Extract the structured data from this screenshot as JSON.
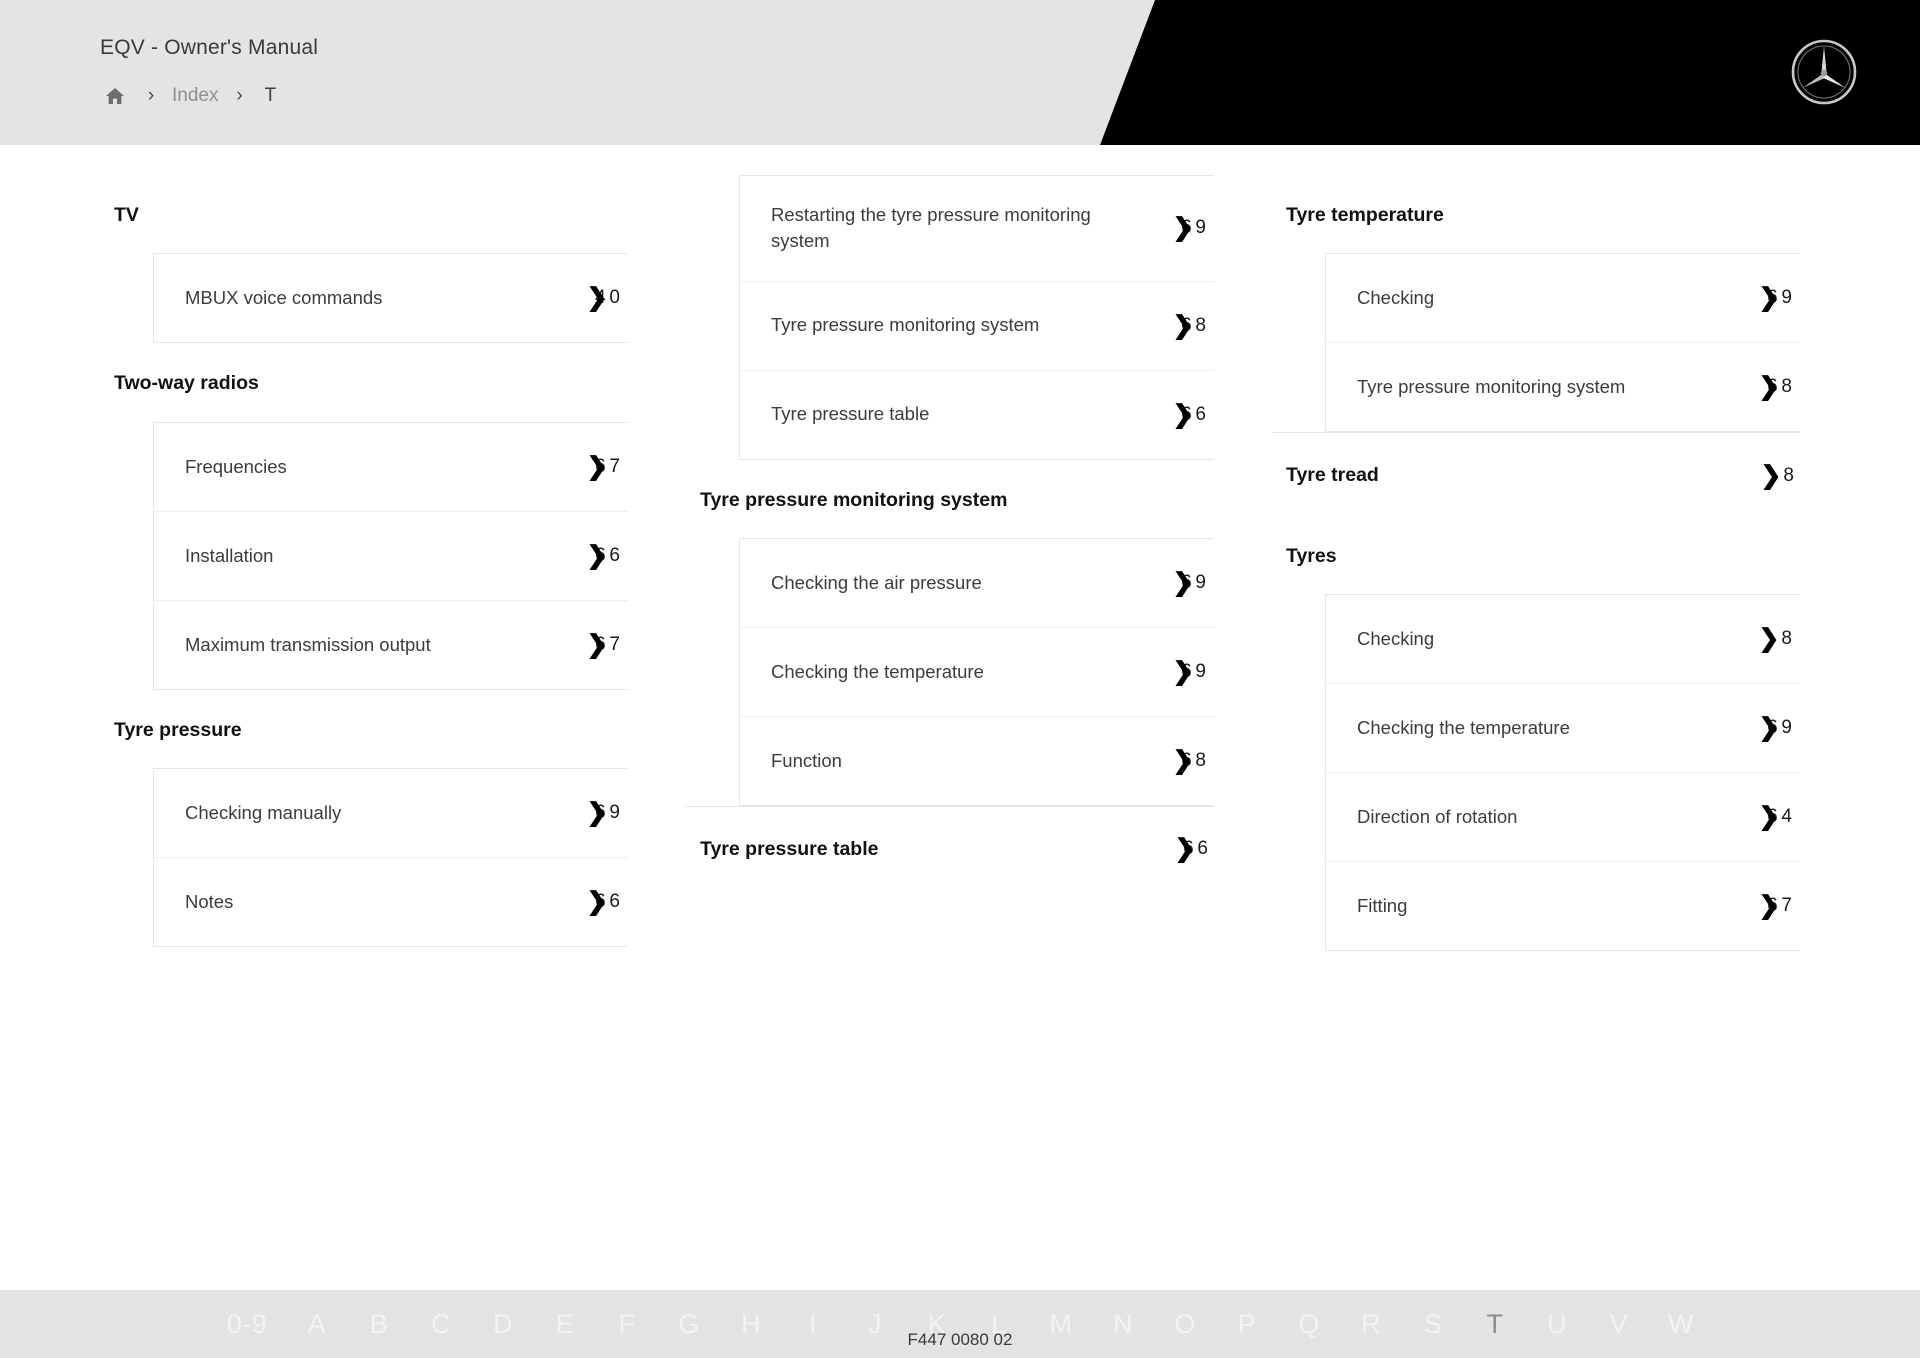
{
  "header": {
    "title": "EQV - Owner's Manual",
    "breadcrumb": {
      "home_icon": "home-icon",
      "separator": "›",
      "index_label": "Index",
      "current_label": "T"
    },
    "brand_logo": "mercedes-star-icon",
    "accent_bg": "#000000",
    "header_bg": "#e4e4e4"
  },
  "index": {
    "columns": [
      {
        "groups": [
          {
            "heading": "TV",
            "heading_page": null,
            "entries": [
              {
                "label": "MBUX voice commands",
                "page": "4",
                "page_tail": "0"
              }
            ]
          },
          {
            "heading": "Two-way radios",
            "heading_page": null,
            "entries": [
              {
                "label": "Frequencies",
                "page": "6",
                "page_tail": "7"
              },
              {
                "label": "Installation",
                "page": "6",
                "page_tail": "6"
              },
              {
                "label": "Maximum transmission output",
                "page": "6",
                "page_tail": "7"
              }
            ]
          },
          {
            "heading": "Tyre pressure",
            "heading_page": null,
            "entries": [
              {
                "label": "Checking manually",
                "page": "6",
                "page_tail": "9"
              },
              {
                "label": "Notes",
                "page": "6",
                "page_tail": "6"
              }
            ]
          }
        ]
      },
      {
        "groups": [
          {
            "heading": null,
            "heading_page": null,
            "entries": [
              {
                "label": "Restarting the tyre pressure monitoring system",
                "page": "6",
                "page_tail": "9"
              },
              {
                "label": "Tyre pressure monitoring system",
                "page": "6",
                "page_tail": "8"
              },
              {
                "label": "Tyre pressure table",
                "page": "6",
                "page_tail": "6"
              }
            ]
          },
          {
            "heading": "Tyre pressure monitoring system",
            "heading_page": null,
            "entries": [
              {
                "label": "Checking the air pressure",
                "page": "6",
                "page_tail": "9"
              },
              {
                "label": "Checking the temperature",
                "page": "6",
                "page_tail": "9"
              },
              {
                "label": "Function",
                "page": "6",
                "page_tail": "8"
              }
            ]
          },
          {
            "heading": "Tyre pressure table",
            "heading_page": "6",
            "heading_page_tail": "6",
            "entries": []
          }
        ]
      },
      {
        "groups": [
          {
            "heading": "Tyre temperature",
            "heading_page": null,
            "entries": [
              {
                "label": "Checking",
                "page": "6",
                "page_tail": "9"
              },
              {
                "label": "Tyre pressure monitoring system",
                "page": "6",
                "page_tail": "8"
              }
            ]
          },
          {
            "heading": "Tyre tread",
            "heading_page": "",
            "heading_page_tail": "8",
            "entries": []
          },
          {
            "heading": "Tyres",
            "heading_page": null,
            "entries": [
              {
                "label": "Checking",
                "page": "",
                "page_tail": "8"
              },
              {
                "label": "Checking the temperature",
                "page": "6",
                "page_tail": "9"
              },
              {
                "label": "Direction of rotation",
                "page": "6",
                "page_tail": "4"
              },
              {
                "label": "Fitting",
                "page": "6",
                "page_tail": "7"
              }
            ]
          }
        ]
      }
    ]
  },
  "alpha_nav": {
    "letters": [
      "0-9",
      "A",
      "B",
      "C",
      "D",
      "E",
      "F",
      "G",
      "H",
      "I",
      "J",
      "K",
      "L",
      "M",
      "N",
      "O",
      "P",
      "Q",
      "R",
      "S",
      "T",
      "U",
      "V",
      "W"
    ],
    "active": "T",
    "bar_bg": "#e3e3e3",
    "letter_color": "#f2f2f2",
    "active_color": "#8d8d8d"
  },
  "footer": {
    "doc_code": "F447 0080 02"
  }
}
